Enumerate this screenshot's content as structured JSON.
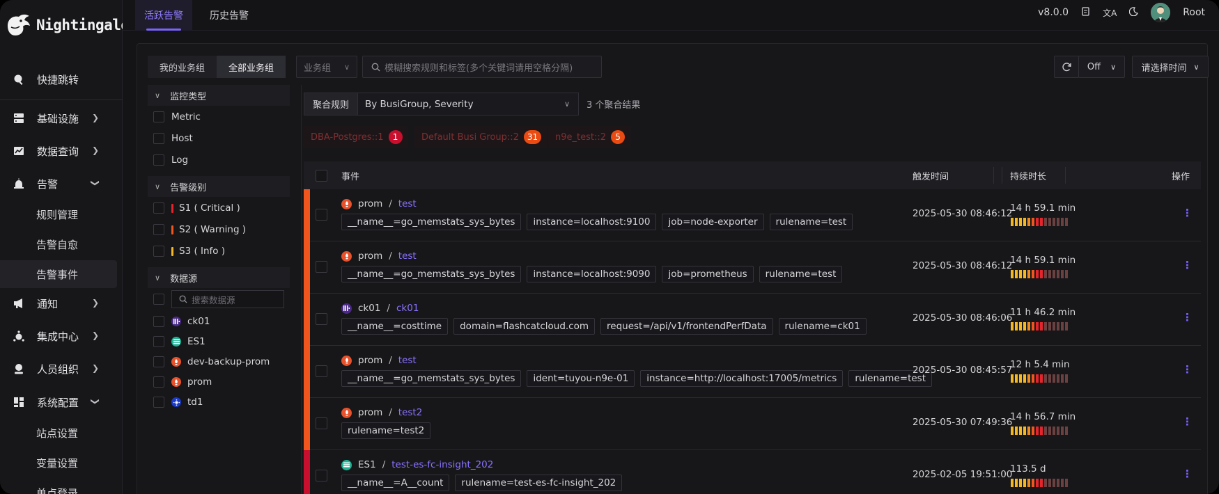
{
  "app": {
    "name": "Nightingale",
    "version": "v8.0.0",
    "user": "Root"
  },
  "sidebar": {
    "items": [
      {
        "label": "快捷跳转",
        "icon": "search-icon"
      },
      {
        "label": "基础设施",
        "icon": "server-icon"
      },
      {
        "label": "数据查询",
        "icon": "chart-icon"
      },
      {
        "label": "告警",
        "icon": "alarm-icon"
      },
      {
        "label": "通知",
        "icon": "megaphone-icon"
      },
      {
        "label": "集成中心",
        "icon": "plugin-icon"
      },
      {
        "label": "人员组织",
        "icon": "user-icon"
      },
      {
        "label": "系统配置",
        "icon": "grid-icon"
      }
    ],
    "alert_sub": [
      "规则管理",
      "告警自愈",
      "告警事件"
    ],
    "config_sub": [
      "站点设置",
      "变量设置",
      "单点登录"
    ]
  },
  "tabs": [
    "活跃告警",
    "历史告警"
  ],
  "toolbar": {
    "my_groups": "我的业务组",
    "all_groups": "全部业务组",
    "busigroup_placeholder": "业务组",
    "search_placeholder": "模糊搜索规则和标签(多个关键词请用空格分隔)",
    "refresh_value": "Off",
    "time_placeholder": "请选择时间"
  },
  "filters": {
    "monitor_type": {
      "title": "监控类型",
      "items": [
        "Metric",
        "Host",
        "Log"
      ]
    },
    "severity": {
      "title": "告警级别",
      "items": [
        {
          "label": "S1 ( Critical )",
          "color": "#e5242b"
        },
        {
          "label": "S2 ( Warning )",
          "color": "#f0561d"
        },
        {
          "label": "S3 ( Info )",
          "color": "#f5b821"
        }
      ]
    },
    "datasource": {
      "title": "数据源",
      "search_placeholder": "搜索数据源",
      "items": [
        {
          "label": "ck01",
          "icon": "clickhouse-icon"
        },
        {
          "label": "ES1",
          "icon": "elasticsearch-icon"
        },
        {
          "label": "dev-backup-prom",
          "icon": "prometheus-icon"
        },
        {
          "label": "prom",
          "icon": "prometheus-icon"
        },
        {
          "label": "td1",
          "icon": "tdengine-icon"
        }
      ]
    }
  },
  "aggregation": {
    "label": "聚合规则",
    "value": "By BusiGroup, Severity",
    "count": "3 个聚合结果",
    "chips": [
      {
        "label": "DBA-Postgres::1",
        "count": "1",
        "color": "#c8102e"
      },
      {
        "label": "Default Busi Group::2",
        "count": "31",
        "color": "#ea4b12"
      },
      {
        "label": "n9e_test::2",
        "count": "5",
        "color": "#ea4b12"
      }
    ]
  },
  "table": {
    "headers": {
      "event": "事件",
      "trigger_time": "触发时间",
      "duration": "持续时长",
      "ops": "操作"
    },
    "rows": [
      {
        "source": "prom",
        "rule": "test",
        "icon": "prometheus-icon",
        "sev_color": "#f0561d",
        "tags": [
          "__name__=go_memstats_sys_bytes",
          "instance=localhost:9100",
          "job=node-exporter",
          "rulename=test"
        ],
        "time": "2025-05-30 08:46:12",
        "duration": "14 h 59.1 min"
      },
      {
        "source": "prom",
        "rule": "test",
        "icon": "prometheus-icon",
        "sev_color": "#f0561d",
        "tags": [
          "__name__=go_memstats_sys_bytes",
          "instance=localhost:9090",
          "job=prometheus",
          "rulename=test"
        ],
        "time": "2025-05-30 08:46:12",
        "duration": "14 h 59.1 min"
      },
      {
        "source": "ck01",
        "rule": "ck01",
        "icon": "clickhouse-icon",
        "sev_color": "#f0561d",
        "tags": [
          "__name__=costtime",
          "domain=flashcatcloud.com",
          "request=/api/v1/frontendPerfData",
          "rulename=ck01"
        ],
        "time": "2025-05-30 08:46:06",
        "duration": "11 h 46.2 min"
      },
      {
        "source": "prom",
        "rule": "test",
        "icon": "prometheus-icon",
        "sev_color": "#f0561d",
        "tags": [
          "__name__=go_memstats_sys_bytes",
          "ident=tuyou-n9e-01",
          "instance=http://localhost:17005/metrics",
          "rulename=test"
        ],
        "time": "2025-05-30 08:45:57",
        "duration": "12 h 5.4 min"
      },
      {
        "source": "prom",
        "rule": "test2",
        "icon": "prometheus-icon",
        "sev_color": "#f0561d",
        "tags": [
          "rulename=test2"
        ],
        "time": "2025-05-30 07:49:36",
        "duration": "14 h 56.7 min"
      },
      {
        "source": "ES1",
        "rule": "test-es-fc-insight_202",
        "icon": "elasticsearch-icon",
        "sev_color": "#c8102e",
        "tags": [
          "__name__=A__count",
          "rulename=test-es-fc-insight_202"
        ],
        "time": "2025-02-05 19:51:00",
        "duration": "113.5 d"
      }
    ]
  }
}
